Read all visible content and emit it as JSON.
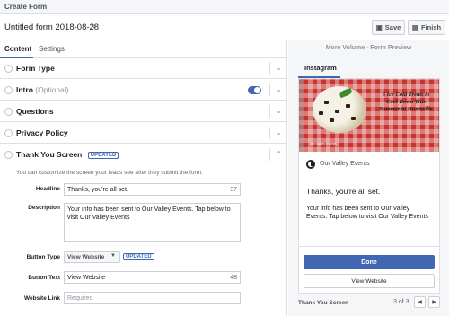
{
  "app": {
    "title": "Create Form"
  },
  "form": {
    "name": "Untitled form 2018-08-28",
    "save_label": "Save",
    "finish_label": "Finish"
  },
  "editor": {
    "tabs": [
      "Content",
      "Settings"
    ],
    "sections": {
      "form_type": "Form Type",
      "intro": "Intro",
      "intro_optional": "(Optional)",
      "questions": "Questions",
      "privacy_policy": "Privacy Policy",
      "thank_you": "Thank You Screen"
    },
    "thank_you_badge": "UPDATED",
    "thank_you_desc": "You can customize the screen your leads see after they submit the form.",
    "fields": {
      "headline_label": "Headline",
      "headline_value": "Thanks, you're all set.",
      "headline_count": "37",
      "description_label": "Description",
      "description_value": "Your info has been sent to Our Valley Events. Tap below to visit Our Valley Events",
      "button_type_label": "Button Type",
      "button_type_value": "View Website",
      "button_type_badge": "UPDATED",
      "button_text_label": "Button Text",
      "button_text_value": "View Website",
      "button_text_count": "48",
      "website_link_label": "Website Link",
      "website_link_placeholder": "Required"
    }
  },
  "preview": {
    "title": "More Volume - Form Preview",
    "tab": "Instagram",
    "hero_headline": "6 Ice Cold Treats to Cool Down This Summer in Huntsville",
    "hero_small": "our valley events",
    "page_name": "Our Valley Events",
    "headline": "Thanks, you're all set.",
    "body": "Your info has been sent to Our Valley Events. Tap below to visit Our Valley Events",
    "done_label": "Done",
    "website_label": "View Website",
    "footer_label": "Thank You Screen",
    "pager": "3 of 3"
  }
}
